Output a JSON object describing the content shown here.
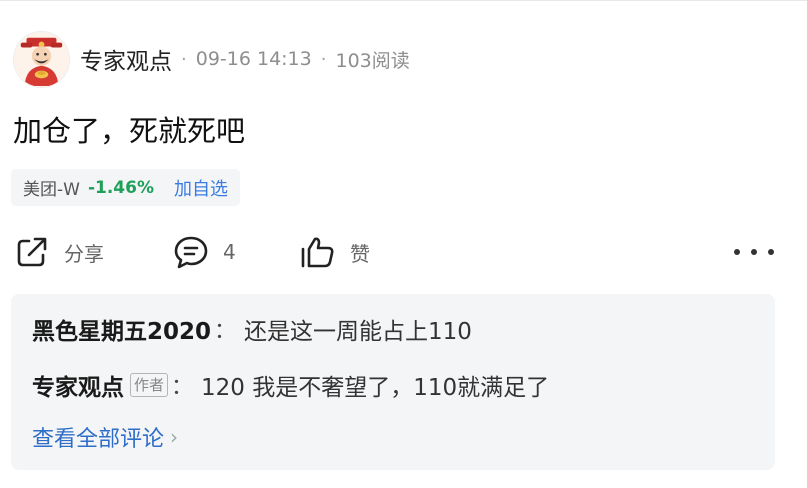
{
  "post": {
    "author": "专家观点",
    "time": "09-16 14:13",
    "reads": "103阅读",
    "content": "加仓了，死就死吧"
  },
  "stock_tag": {
    "name": "美团-W",
    "change": "-1.46%",
    "change_color": "#1fa05a",
    "add_label": "加自选",
    "add_color": "#3a7be2"
  },
  "actions": {
    "share_label": "分享",
    "share_icon": "share-icon",
    "comment_count": "4",
    "comment_icon": "comment-bubble-icon",
    "like_label": "赞",
    "like_icon": "thumbs-up-icon",
    "more_icon": "more-dots-icon"
  },
  "comments": [
    {
      "name": "黑色星期五2020",
      "colon": "：",
      "text": "还是这一周能占上110"
    },
    {
      "name": "专家观点",
      "badge": "作者",
      "colon": "：",
      "text": "120 我是不奢望了，110就满足了"
    }
  ],
  "view_all": "查看全部评论"
}
